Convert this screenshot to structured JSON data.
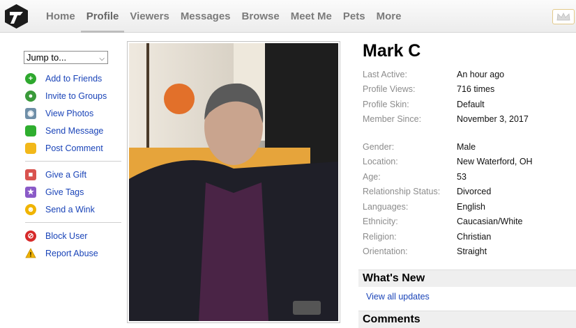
{
  "nav": {
    "items": [
      "Home",
      "Profile",
      "Viewers",
      "Messages",
      "Browse",
      "Meet Me",
      "Pets",
      "More"
    ],
    "active": "Profile"
  },
  "sidebar": {
    "jump_label": "Jump to...",
    "group1": [
      {
        "label": "Add to Friends",
        "icon": "plus-circle-icon"
      },
      {
        "label": "Invite to Groups",
        "icon": "group-icon"
      },
      {
        "label": "View Photos",
        "icon": "camera-icon"
      },
      {
        "label": "Send Message",
        "icon": "speech-bubble-icon"
      },
      {
        "label": "Post Comment",
        "icon": "comment-icon"
      }
    ],
    "group2": [
      {
        "label": "Give a Gift",
        "icon": "gift-icon"
      },
      {
        "label": "Give Tags",
        "icon": "star-icon"
      },
      {
        "label": "Send a Wink",
        "icon": "wink-icon"
      }
    ],
    "group3": [
      {
        "label": "Block User",
        "icon": "block-icon"
      },
      {
        "label": "Report Abuse",
        "icon": "warning-icon"
      }
    ]
  },
  "profile": {
    "name": "Mark C",
    "activity": [
      {
        "k": "Last Active:",
        "v": "An hour ago"
      },
      {
        "k": "Profile Views:",
        "v": "716 times"
      },
      {
        "k": "Profile Skin:",
        "v": "Default"
      },
      {
        "k": "Member Since:",
        "v": "November 3, 2017"
      }
    ],
    "details": [
      {
        "k": "Gender:",
        "v": "Male"
      },
      {
        "k": "Location:",
        "v": "New Waterford, OH"
      },
      {
        "k": "Age:",
        "v": "53"
      },
      {
        "k": "Relationship Status:",
        "v": "Divorced"
      },
      {
        "k": "Languages:",
        "v": "English"
      },
      {
        "k": "Ethnicity:",
        "v": "Caucasian/White"
      },
      {
        "k": "Religion:",
        "v": "Christian"
      },
      {
        "k": "Orientation:",
        "v": "Straight"
      }
    ]
  },
  "whats_new": {
    "title": "What's New",
    "link": "View all updates"
  },
  "comments": {
    "title": "Comments"
  },
  "colors": {
    "link": "#1a44b8",
    "nav_text": "#7b7b7b",
    "label_gray": "#8c8c8c"
  }
}
